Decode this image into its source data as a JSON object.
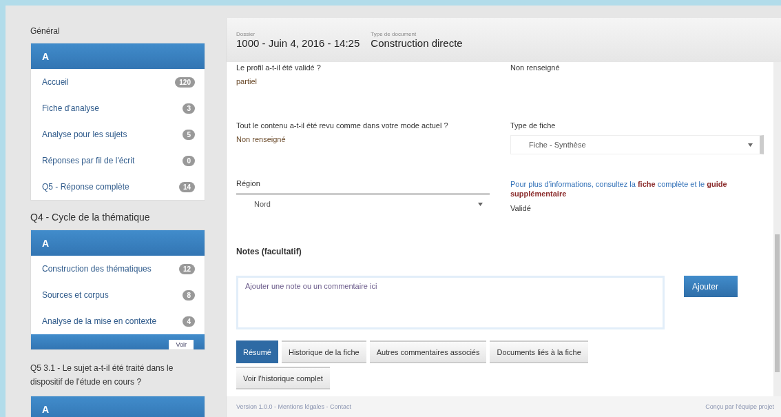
{
  "sidebar": {
    "sections": [
      {
        "heading": "Général",
        "panel": {
          "header": "A",
          "items": [
            {
              "label": "Accueil",
              "count": "120"
            },
            {
              "label": "Fiche d'analyse",
              "count": "3"
            },
            {
              "label": "Analyse pour les sujets",
              "count": "5"
            },
            {
              "label": "Réponses par fil de l'écrit",
              "count": "0"
            },
            {
              "label": "Q5 - Réponse complète",
              "count": "14"
            }
          ]
        }
      },
      {
        "heading": "Q4 - Cycle de la thématique",
        "panel": {
          "header": "A",
          "items": [
            {
              "label": "Construction des thématiques",
              "count": "12"
            },
            {
              "label": "Sources et corpus",
              "count": "8"
            },
            {
              "label": "Analyse de la mise en contexte",
              "count": "4"
            }
          ],
          "button": "Voir"
        }
      },
      {
        "heading": "Q5 3.1 - Le sujet a-t-il été traité dans le dispositif de l'étude en cours ?",
        "panel": {
          "header": "A"
        }
      }
    ]
  },
  "header": {
    "fields": [
      {
        "label": "Dossier",
        "value": "1000 - Juin 4, 2016 - 14:25"
      },
      {
        "label": "Type de document",
        "value": "Construction directe"
      }
    ]
  },
  "form": {
    "rows": [
      [
        {
          "kind": "text",
          "label": "Le profil a-t-il été validé ?",
          "value": "partiel"
        },
        {
          "kind": "value",
          "value": "Non renseigné"
        }
      ],
      [
        {
          "kind": "text",
          "label": "Tout le contenu a-t-il été revu comme dans votre mode actuel ?",
          "value": "Non renseigné"
        },
        {
          "kind": "select",
          "label": "Type de fiche",
          "value": "Fiche - Synthèse"
        }
      ],
      [
        {
          "kind": "select",
          "label": "Région",
          "value": "Nord"
        },
        {
          "kind": "note",
          "text": "Pour plus d'informations, consultez la **fiche** complète et le **guide supplémentaire**",
          "value": "Validé"
        }
      ]
    ],
    "notes_label": "Notes (facultatif)",
    "notes_placeholder": "Ajouter une note ou un commentaire ici",
    "submit": "Ajouter"
  },
  "tabs": [
    {
      "label": "Résumé",
      "selected": true
    },
    {
      "label": "Historique de la fiche",
      "selected": false
    },
    {
      "label": "Autres commentaires associés",
      "selected": false
    },
    {
      "label": "Documents liés à la fiche",
      "selected": false
    },
    {
      "label": "Voir l'historique complet",
      "selected": false
    }
  ],
  "footer": {
    "left": "Version 1.0.0 - Mentions légales - Contact",
    "right": "Conçu par l'équipe projet"
  }
}
